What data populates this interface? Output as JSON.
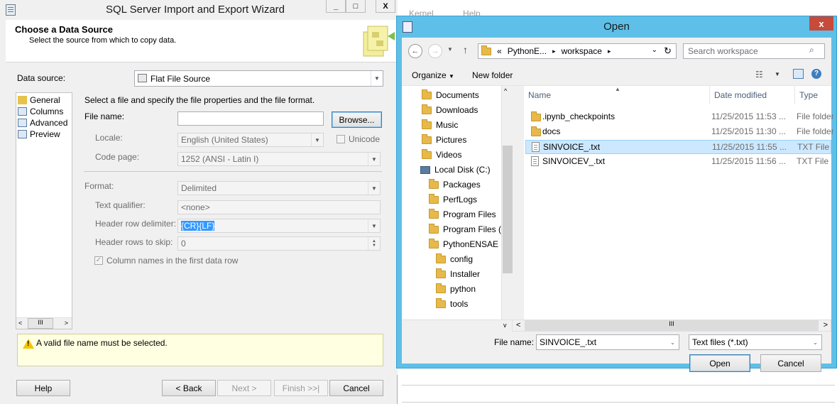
{
  "background_app": {
    "menu": [
      "Kernel",
      "Help"
    ]
  },
  "wizard": {
    "title": "SQL Server Import and Export Wizard",
    "window_buttons": [
      "_",
      "□",
      "X"
    ],
    "header_title": "Choose a Data Source",
    "header_subtitle": "Select the source from which to copy data.",
    "data_source_label": "Data source:",
    "data_source_value": "Flat File Source",
    "nav_items": [
      "General",
      "Columns",
      "Advanced",
      "Preview"
    ],
    "nav_scroll": [
      "<",
      "III",
      ">"
    ],
    "instruction": "Select a file and specify the file properties and the file format.",
    "file_name_label": "File name:",
    "file_name_value": "",
    "browse_label": "Browse...",
    "locale_label": "Locale:",
    "locale_value": "English (United States)",
    "unicode_label": "Unicode",
    "code_page_label": "Code page:",
    "code_page_value": "1252  (ANSI - Latin I)",
    "format_label": "Format:",
    "format_value": "Delimited",
    "text_qualifier_label": "Text qualifier:",
    "text_qualifier_value": "<none>",
    "header_row_delim_label": "Header row delimiter:",
    "header_row_delim_value": "{CR}{LF}",
    "header_rows_skip_label": "Header rows to skip:",
    "header_rows_skip_value": "0",
    "column_names_label": "Column names in the first data row",
    "column_names_checked": true,
    "message": "A valid file name must be selected.",
    "buttons": {
      "help": "Help",
      "back": "< Back",
      "next": "Next >",
      "finish": "Finish >>|",
      "cancel": "Cancel"
    }
  },
  "open_dialog": {
    "title": "Open",
    "close": "x",
    "address": [
      "«",
      "PythonE...",
      "▸",
      "workspace",
      "▸"
    ],
    "search_placeholder": "Search workspace",
    "organize_label": "Organize",
    "new_folder_label": "New folder",
    "tree": [
      {
        "label": "Documents",
        "icon": "documents-folder-icon"
      },
      {
        "label": "Downloads",
        "icon": "downloads-folder-icon"
      },
      {
        "label": "Music",
        "icon": "music-folder-icon"
      },
      {
        "label": "Pictures",
        "icon": "pictures-folder-icon"
      },
      {
        "label": "Videos",
        "icon": "videos-folder-icon"
      },
      {
        "label": "Local Disk (C:)",
        "icon": "drive-icon"
      },
      {
        "label": "Packages",
        "icon": "folder-icon"
      },
      {
        "label": "PerfLogs",
        "icon": "folder-icon"
      },
      {
        "label": "Program Files",
        "icon": "folder-icon"
      },
      {
        "label": "Program Files (",
        "icon": "folder-icon"
      },
      {
        "label": "PythonENSAE",
        "icon": "folder-icon"
      },
      {
        "label": "config",
        "icon": "folder-icon"
      },
      {
        "label": "Installer",
        "icon": "folder-icon"
      },
      {
        "label": "python",
        "icon": "folder-icon"
      },
      {
        "label": "tools",
        "icon": "folder-icon"
      }
    ],
    "columns": [
      "Name",
      "Date modified",
      "Type"
    ],
    "files": [
      {
        "name": ".ipynb_checkpoints",
        "date": "11/25/2015 11:53 ...",
        "type": "File folder",
        "kind": "folder",
        "selected": false
      },
      {
        "name": "docs",
        "date": "11/25/2015 11:30 ...",
        "type": "File folder",
        "kind": "folder",
        "selected": false
      },
      {
        "name": "SINVOICE_.txt",
        "date": "11/25/2015 11:55 ...",
        "type": "TXT File",
        "kind": "txt",
        "selected": true
      },
      {
        "name": "SINVOICEV_.txt",
        "date": "11/25/2015 11:56 ...",
        "type": "TXT File",
        "kind": "txt",
        "selected": false
      }
    ],
    "hscroll_glyph": "III",
    "file_name_label": "File name:",
    "file_name_value": "SINVOICE_.txt",
    "file_type_value": "Text files (*.txt)",
    "open_label": "Open",
    "cancel_label": "Cancel"
  }
}
